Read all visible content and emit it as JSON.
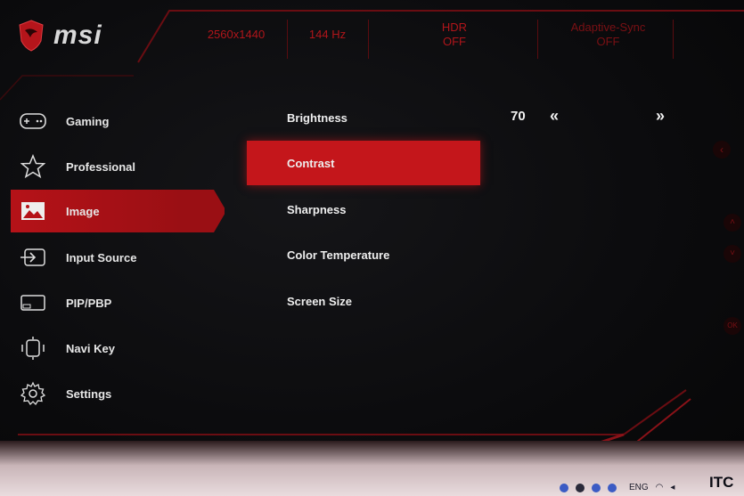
{
  "brand": {
    "name": "msi"
  },
  "status": {
    "resolution": "2560x1440",
    "refresh": "144 Hz",
    "hdr_label": "HDR",
    "hdr_value": "OFF",
    "sync_label": "Adaptive-Sync",
    "sync_value": "OFF"
  },
  "sidebar": {
    "items": [
      {
        "label": "Gaming",
        "icon": "gamepad-icon"
      },
      {
        "label": "Professional",
        "icon": "star-icon"
      },
      {
        "label": "Image",
        "icon": "image-icon",
        "active": true
      },
      {
        "label": "Input Source",
        "icon": "input-source-icon"
      },
      {
        "label": "PIP/PBP",
        "icon": "pip-icon"
      },
      {
        "label": "Navi Key",
        "icon": "navi-key-icon"
      },
      {
        "label": "Settings",
        "icon": "gear-icon"
      }
    ]
  },
  "menu": {
    "items": [
      {
        "label": "Brightness"
      },
      {
        "label": "Contrast",
        "active": true
      },
      {
        "label": "Sharpness"
      },
      {
        "label": "Color Temperature"
      },
      {
        "label": "Screen Size"
      }
    ],
    "brightness_value": "70",
    "arrow_left": "«",
    "arrow_right": "»"
  },
  "side_buttons": {
    "ok": "OK"
  },
  "taskbar": {
    "language": "ENG"
  },
  "watermark": "ITC",
  "colors": {
    "accent": "#c4161b",
    "dark_red": "#5a0c10",
    "background": "#0a0a0c"
  }
}
